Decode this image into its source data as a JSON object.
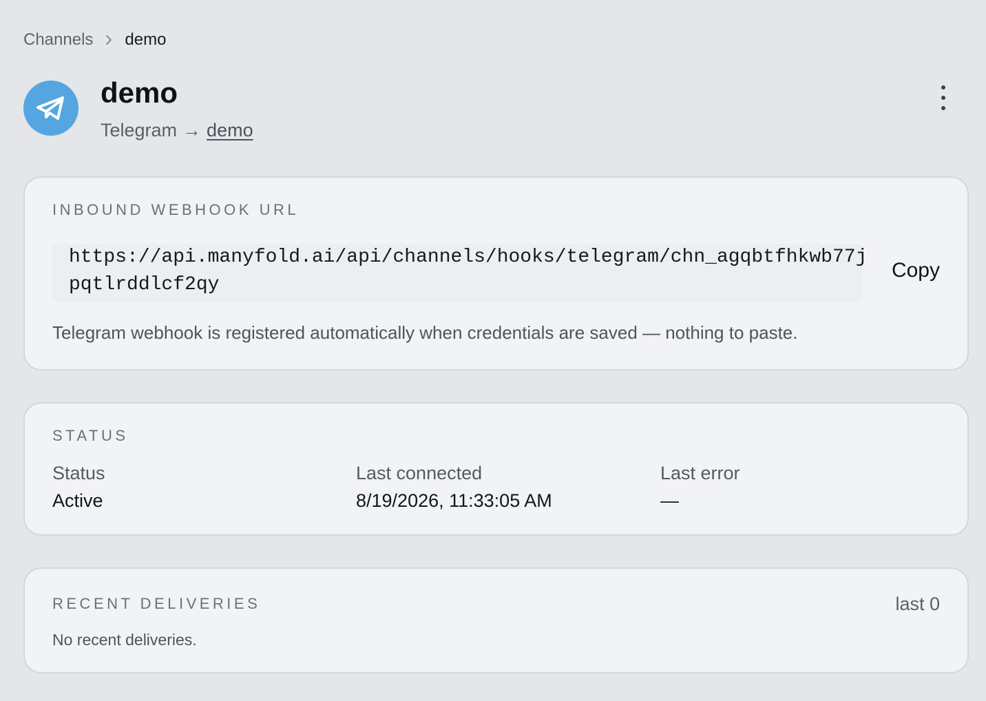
{
  "breadcrumb": {
    "parent": "Channels",
    "current": "demo"
  },
  "channel": {
    "name": "demo",
    "provider": "Telegram",
    "arrow": "→",
    "target": "demo",
    "icon": "telegram-icon",
    "icon_color": "#55a5e0"
  },
  "webhook": {
    "label": "INBOUND WEBHOOK URL",
    "url": "https://api.manyfold.ai/api/channels/hooks/telegram/chn_agqbtfhkwb77jpqtlrddlcf2qy",
    "copy_label": "Copy",
    "hint": "Telegram webhook is registered automatically when credentials are saved — nothing to paste."
  },
  "status": {
    "label": "STATUS",
    "fields": [
      {
        "key": "Status",
        "value": "Active"
      },
      {
        "key": "Last connected",
        "value": "8/19/2026, 11:33:05 AM"
      },
      {
        "key": "Last error",
        "value": "—"
      }
    ]
  },
  "deliveries": {
    "label": "RECENT DELIVERIES",
    "count_label": "last 0",
    "empty_text": "No recent deliveries."
  }
}
